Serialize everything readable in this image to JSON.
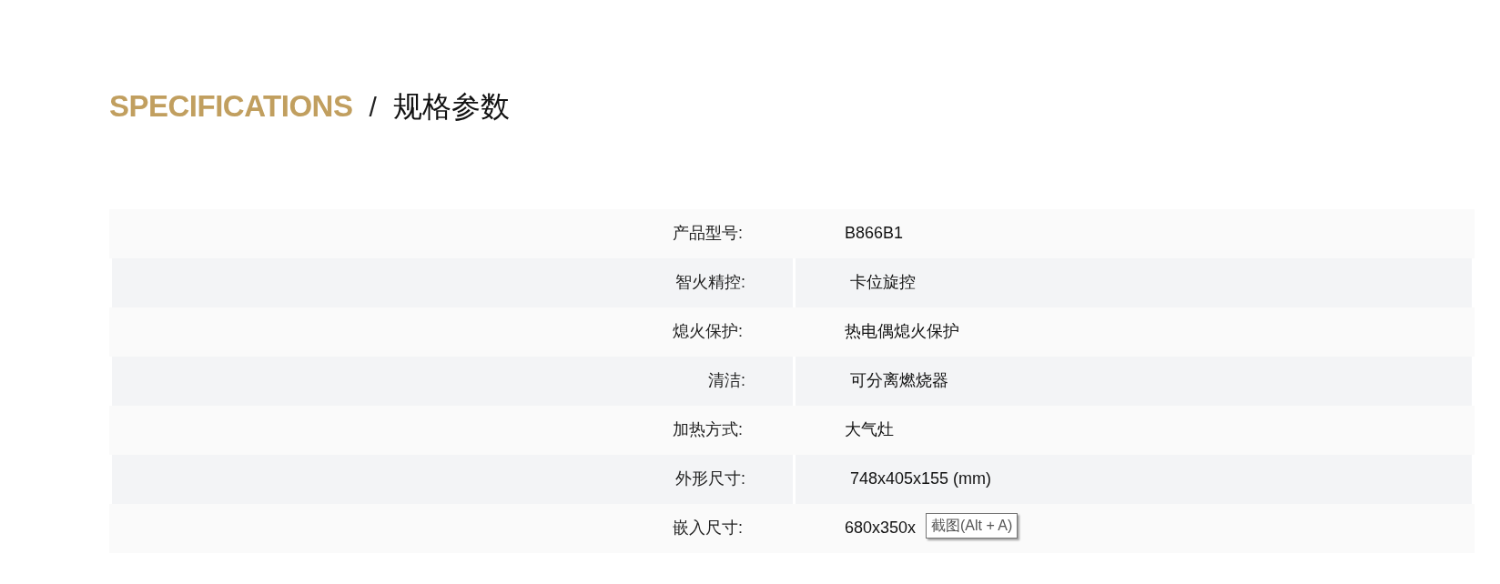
{
  "heading": {
    "title": "SPECIFICATIONS",
    "separator": "/",
    "subtitle": "规格参数"
  },
  "specs": [
    {
      "label": "产品型号:",
      "value": "B866B1"
    },
    {
      "label": "智火精控:",
      "value": "卡位旋控"
    },
    {
      "label": "熄火保护:",
      "value": "热电偶熄火保护"
    },
    {
      "label": "清洁:",
      "value": "可分离燃烧器"
    },
    {
      "label": "加热方式:",
      "value": "大气灶"
    },
    {
      "label": "外形尺寸:",
      "value": "748x405x155 (mm)"
    },
    {
      "label": "嵌入尺寸:",
      "value": "680x350x"
    }
  ],
  "tooltip": "截图(Alt + A)"
}
